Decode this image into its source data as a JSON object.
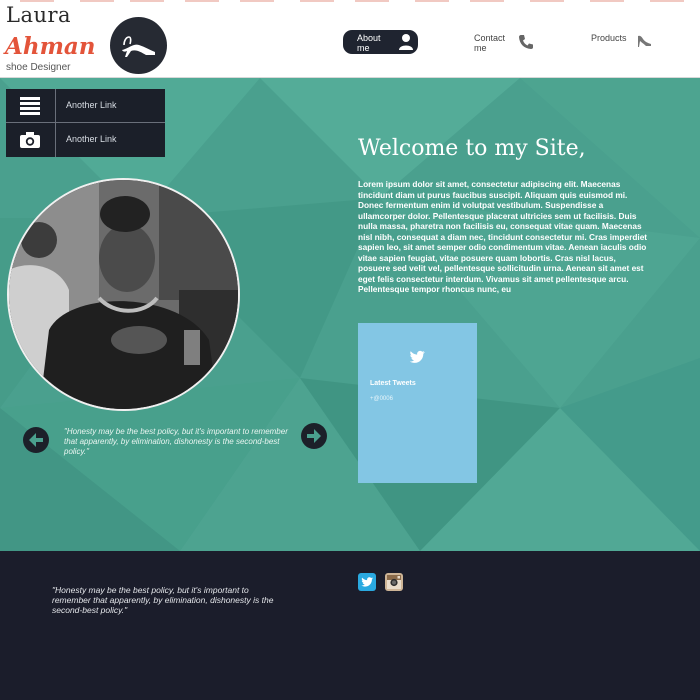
{
  "colors": {
    "accent": "#e3543a",
    "hero_bg": "#4aa08e",
    "dark": "#1b1d2b",
    "tweet_card": "#83c6e4"
  },
  "logo": {
    "first_name": "Laura",
    "last_name": "Ahman",
    "tagline": "shoe Designer",
    "icon": "high-heel-shoe-icon"
  },
  "nav": {
    "items": [
      {
        "label": "About me",
        "icon": "user-icon",
        "active": true
      },
      {
        "label": "Contact me",
        "icon": "phone-icon",
        "active": false
      },
      {
        "label": "Products",
        "icon": "shoe-icon",
        "active": false
      }
    ]
  },
  "side_menu": {
    "items": [
      {
        "label": "Another Link",
        "icon": "list-icon"
      },
      {
        "label": "Another Link",
        "icon": "camera-icon"
      }
    ]
  },
  "hero": {
    "title": "Welcome to my Site,",
    "body": "Lorem ipsum dolor sit amet, consectetur adipiscing elit. Maecenas tincidunt diam ut purus faucibus suscipit. Aliquam quis euismod mi. Donec fermentum enim id volutpat vestibulum. Suspendisse a ullamcorper dolor. Pellentesque placerat ultricies sem ut facilisis. Duis nulla massa, pharetra non facilisis eu, consequat vitae quam. Maecenas nisl nibh, consequat a diam nec, tincidunt consectetur mi. Cras imperdiet sapien leo, sit amet semper odio condimentum vitae. Aenean iaculis odio vitae sapien feugiat, vitae posuere quam lobortis. Cras nisl lacus, posuere sed velit vel, pellentesque sollicitudin urna. Aenean sit amet est eget felis consectetur interdum. Vivamus sit amet pellentesque arcu. Pellentesque tempor rhoncus nunc, eu",
    "quote": "\"Honesty may be the best policy, but it's important to remember that apparently, by elimination, dishonesty is the second-best policy.\""
  },
  "tweets": {
    "title": "Latest Tweets",
    "handle": "+@0006",
    "icon": "twitter-bird-icon"
  },
  "footer": {
    "quote": "\"Honesty may be the best policy, but it's important to remember that apparently, by elimination, dishonesty is the second-best policy.\"",
    "social": [
      "twitter-icon",
      "instagram-icon"
    ]
  }
}
